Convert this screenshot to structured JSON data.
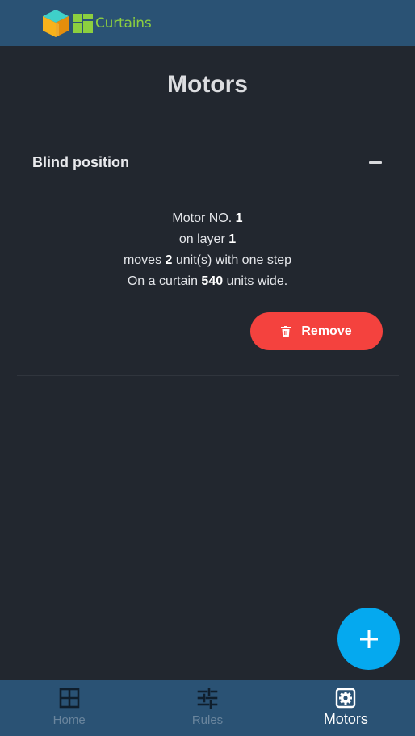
{
  "app": {
    "name": "Curtains"
  },
  "page": {
    "title": "Motors"
  },
  "card": {
    "title": "Blind position",
    "motor": {
      "prefix_no": "Motor NO.",
      "number": "1",
      "prefix_layer": "on layer",
      "layer": "1",
      "prefix_moves": "moves",
      "step_units": "2",
      "suffix_moves": "unit(s) with one step",
      "prefix_curtain": "On a curtain",
      "width_units": "540",
      "suffix_curtain": "units wide."
    },
    "remove_label": "Remove"
  },
  "nav": {
    "items": [
      {
        "label": "Home",
        "icon": "grid-icon",
        "active": false
      },
      {
        "label": "Rules",
        "icon": "sliders-icon",
        "active": false
      },
      {
        "label": "Motors",
        "icon": "gear-icon",
        "active": true
      }
    ]
  },
  "colors": {
    "background": "#22272f",
    "bars": "#2a5274",
    "accent_remove": "#f4423e",
    "accent_fab": "#05a9ef",
    "brand": "#8ccf3f"
  }
}
